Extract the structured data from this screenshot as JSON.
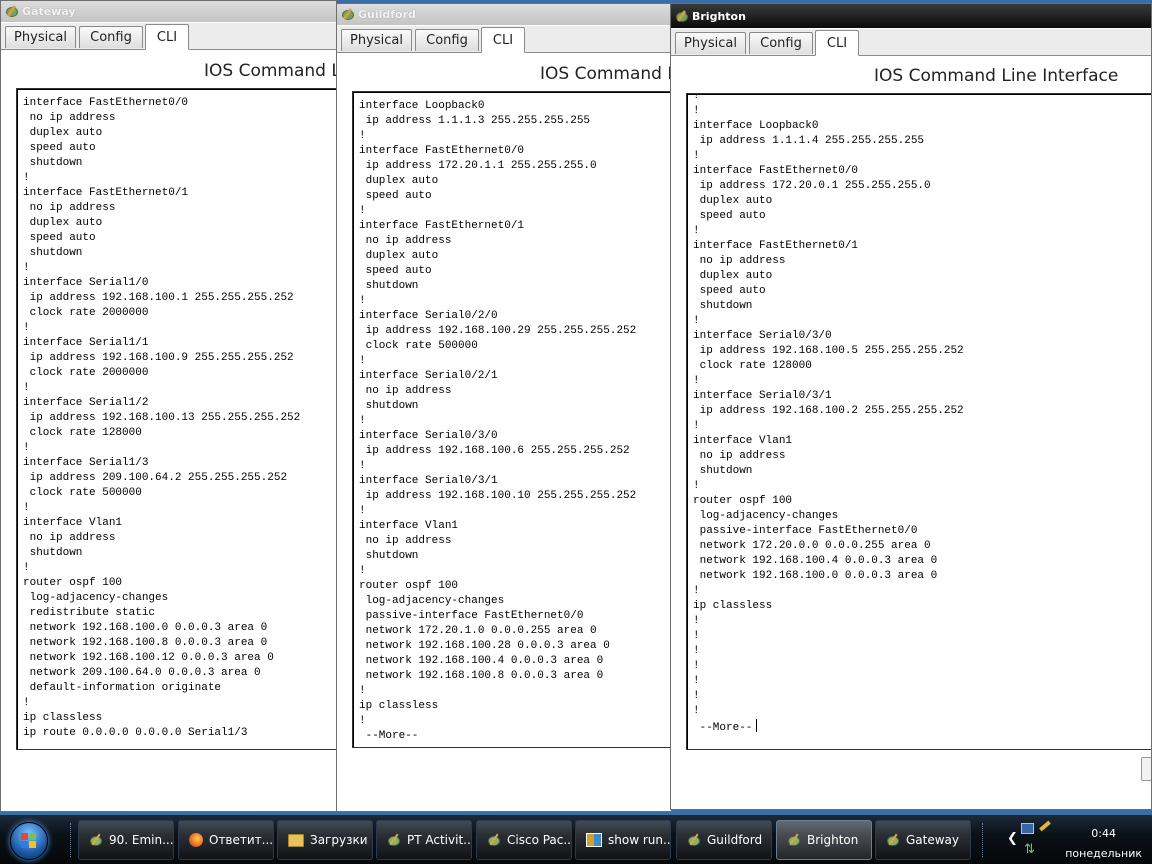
{
  "windows": {
    "gateway": {
      "title": "Gateway",
      "tabs": [
        "Physical",
        "Config",
        "CLI"
      ],
      "heading": "IOS Command L",
      "cli_text": "!\ninterface FastEthernet0/0\n no ip address\n duplex auto\n speed auto\n shutdown\n!\ninterface FastEthernet0/1\n no ip address\n duplex auto\n speed auto\n shutdown\n!\ninterface Serial1/0\n ip address 192.168.100.1 255.255.255.252\n clock rate 2000000\n!\ninterface Serial1/1\n ip address 192.168.100.9 255.255.255.252\n clock rate 2000000\n!\ninterface Serial1/2\n ip address 192.168.100.13 255.255.255.252\n clock rate 128000\n!\ninterface Serial1/3\n ip address 209.100.64.2 255.255.255.252\n clock rate 500000\n!\ninterface Vlan1\n no ip address\n shutdown\n!\nrouter ospf 100\n log-adjacency-changes\n redistribute static\n network 192.168.100.0 0.0.0.3 area 0\n network 192.168.100.8 0.0.0.3 area 0\n network 192.168.100.12 0.0.0.3 area 0\n network 209.100.64.0 0.0.0.3 area 0\n default-information originate\n!\nip classless\nip route 0.0.0.0 0.0.0.0 Serial1/3"
    },
    "guildford": {
      "title": "Guildford",
      "tabs": [
        "Physical",
        "Config",
        "CLI"
      ],
      "heading": "IOS Command L",
      "cli_text": "!\ninterface Loopback0\n ip address 1.1.1.3 255.255.255.255\n!\ninterface FastEthernet0/0\n ip address 172.20.1.1 255.255.255.0\n duplex auto\n speed auto\n!\ninterface FastEthernet0/1\n no ip address\n duplex auto\n speed auto\n shutdown\n!\ninterface Serial0/2/0\n ip address 192.168.100.29 255.255.255.252\n clock rate 500000\n!\ninterface Serial0/2/1\n no ip address\n shutdown\n!\ninterface Serial0/3/0\n ip address 192.168.100.6 255.255.255.252\n!\ninterface Serial0/3/1\n ip address 192.168.100.10 255.255.255.252\n!\ninterface Vlan1\n no ip address\n shutdown\n!\nrouter ospf 100\n log-adjacency-changes\n passive-interface FastEthernet0/0\n network 172.20.1.0 0.0.0.255 area 0\n network 192.168.100.28 0.0.0.3 area 0\n network 192.168.100.4 0.0.0.3 area 0\n network 192.168.100.8 0.0.0.3 area 0\n!\nip classless\n!\n --More--"
    },
    "brighton": {
      "title": "Brighton",
      "tabs": [
        "Physical",
        "Config",
        "CLI"
      ],
      "heading": "IOS Command Line Interface",
      "cli_text": "!\n!\ninterface Loopback0\n ip address 1.1.1.4 255.255.255.255\n!\ninterface FastEthernet0/0\n ip address 172.20.0.1 255.255.255.0\n duplex auto\n speed auto\n!\ninterface FastEthernet0/1\n no ip address\n duplex auto\n speed auto\n shutdown\n!\ninterface Serial0/3/0\n ip address 192.168.100.5 255.255.255.252\n clock rate 128000\n!\ninterface Serial0/3/1\n ip address 192.168.100.2 255.255.255.252\n!\ninterface Vlan1\n no ip address\n shutdown\n!\nrouter ospf 100\n log-adjacency-changes\n passive-interface FastEthernet0/0\n network 172.20.0.0 0.0.0.255 area 0\n network 192.168.100.4 0.0.0.3 area 0\n network 192.168.100.0 0.0.0.3 area 0\n!\nip classless\n!\n!\n!\n!\n!\n!\n!\n --More--"
    }
  },
  "taskbar": {
    "buttons": [
      {
        "label": "90. Emin...",
        "icon": "packet-tracer-icon"
      },
      {
        "label": "Ответит...",
        "icon": "firefox-icon"
      },
      {
        "label": "Загрузки",
        "icon": "folder-icon"
      },
      {
        "label": "PT Activit...",
        "icon": "packet-tracer-icon"
      },
      {
        "label": "Cisco Pac...",
        "icon": "packet-tracer-icon"
      },
      {
        "label": "show run...",
        "icon": "document-icon"
      },
      {
        "label": "Guildford",
        "icon": "packet-tracer-icon"
      },
      {
        "label": "Brighton",
        "icon": "packet-tracer-icon"
      },
      {
        "label": "Gateway",
        "icon": "packet-tracer-icon"
      }
    ],
    "clock_time": "0:44",
    "clock_day": "понедельник"
  },
  "colors": {
    "desktop": "#3a6ea5",
    "active_title": "#0a0a0a",
    "inactive_title": "#c4c4c4"
  }
}
